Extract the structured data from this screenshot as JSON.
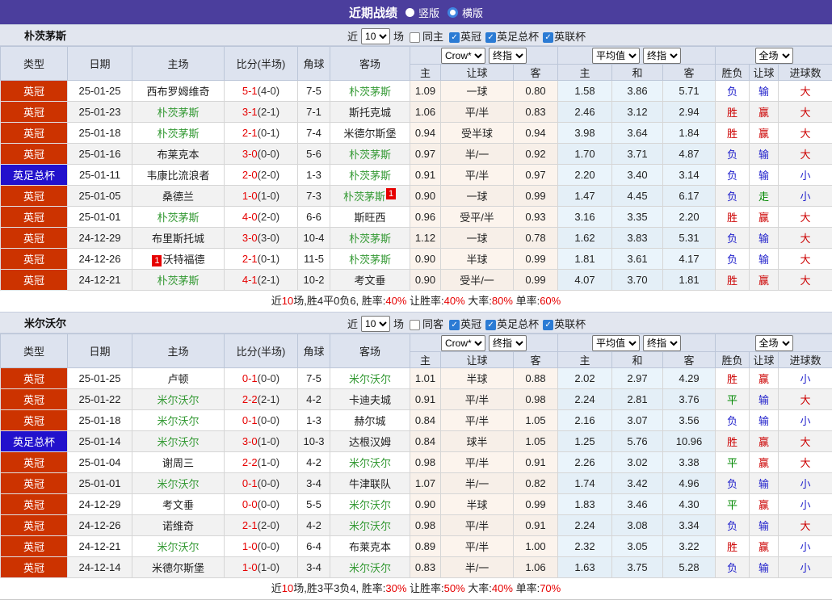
{
  "topbar": {
    "title": "近期战绩",
    "vertical_label": "竖版",
    "horizontal_label": "横版"
  },
  "filter_labels": {
    "near": "近",
    "games_value": "10",
    "games_suffix": "场"
  },
  "table_header": {
    "type": "类型",
    "date": "日期",
    "home": "主场",
    "score": "比分(半场)",
    "corner": "角球",
    "away": "客场",
    "crow_dropdown": "Crow*",
    "crow_final_dropdown": "终指",
    "avg_dropdown": "平均值",
    "avg_final_dropdown": "终指",
    "full_dropdown": "全场",
    "crow_cols": [
      "主",
      "让球",
      "客"
    ],
    "avg_cols": [
      "主",
      "和",
      "客"
    ],
    "result_cols": [
      "胜负",
      "让球",
      "进球数"
    ]
  },
  "colors": {
    "topbar_purple": "#4b3e9d",
    "league_red": "#cc3300",
    "cup_blue": "#2211cc",
    "team_green": "#339933",
    "score_red": "#e60000",
    "win_red": "#cc0000",
    "lose_blue": "#2222cc",
    "draw_green": "#008800"
  },
  "sections": [
    {
      "team": "朴茨茅斯",
      "same_side_label": "同主",
      "same_side_checked": false,
      "league_filters": [
        {
          "label": "英冠",
          "checked": true
        },
        {
          "label": "英足总杯",
          "checked": true
        },
        {
          "label": "英联杯",
          "checked": true
        }
      ],
      "rows": [
        {
          "league": "英冠",
          "league_type": "league",
          "date": "25-01-25",
          "home": "西布罗姆维奇",
          "home_is_team": false,
          "home_card": "",
          "score": "5-1",
          "half": "(4-0)",
          "corners": "7-5",
          "away": "朴茨茅斯",
          "away_is_team": true,
          "away_card": "",
          "crow": [
            "1.09",
            "一球",
            "0.80"
          ],
          "avg": [
            "1.58",
            "3.86",
            "5.71"
          ],
          "results": [
            [
              "负",
              "b"
            ],
            [
              "输",
              "b"
            ],
            [
              "大",
              "r"
            ]
          ]
        },
        {
          "league": "英冠",
          "league_type": "league",
          "date": "25-01-23",
          "home": "朴茨茅斯",
          "home_is_team": true,
          "home_card": "",
          "score": "3-1",
          "half": "(2-1)",
          "corners": "7-1",
          "away": "斯托克城",
          "away_is_team": false,
          "away_card": "",
          "crow": [
            "1.06",
            "平/半",
            "0.83"
          ],
          "avg": [
            "2.46",
            "3.12",
            "2.94"
          ],
          "results": [
            [
              "胜",
              "r"
            ],
            [
              "赢",
              "r"
            ],
            [
              "大",
              "r"
            ]
          ]
        },
        {
          "league": "英冠",
          "league_type": "league",
          "date": "25-01-18",
          "home": "朴茨茅斯",
          "home_is_team": true,
          "home_card": "",
          "score": "2-1",
          "half": "(0-1)",
          "corners": "7-4",
          "away": "米德尔斯堡",
          "away_is_team": false,
          "away_card": "",
          "crow": [
            "0.94",
            "受半球",
            "0.94"
          ],
          "avg": [
            "3.98",
            "3.64",
            "1.84"
          ],
          "results": [
            [
              "胜",
              "r"
            ],
            [
              "赢",
              "r"
            ],
            [
              "大",
              "r"
            ]
          ]
        },
        {
          "league": "英冠",
          "league_type": "league",
          "date": "25-01-16",
          "home": "布莱克本",
          "home_is_team": false,
          "home_card": "",
          "score": "3-0",
          "half": "(0-0)",
          "corners": "5-6",
          "away": "朴茨茅斯",
          "away_is_team": true,
          "away_card": "",
          "crow": [
            "0.97",
            "半/一",
            "0.92"
          ],
          "avg": [
            "1.70",
            "3.71",
            "4.87"
          ],
          "results": [
            [
              "负",
              "b"
            ],
            [
              "输",
              "b"
            ],
            [
              "大",
              "r"
            ]
          ]
        },
        {
          "league": "英足总杯",
          "league_type": "cup",
          "date": "25-01-11",
          "home": "韦康比流浪者",
          "home_is_team": false,
          "home_card": "",
          "score": "2-0",
          "half": "(2-0)",
          "corners": "1-3",
          "away": "朴茨茅斯",
          "away_is_team": true,
          "away_card": "",
          "crow": [
            "0.91",
            "平/半",
            "0.97"
          ],
          "avg": [
            "2.20",
            "3.40",
            "3.14"
          ],
          "results": [
            [
              "负",
              "b"
            ],
            [
              "输",
              "b"
            ],
            [
              "小",
              "b"
            ]
          ]
        },
        {
          "league": "英冠",
          "league_type": "league",
          "date": "25-01-05",
          "home": "桑德兰",
          "home_is_team": false,
          "home_card": "",
          "score": "1-0",
          "half": "(1-0)",
          "corners": "7-3",
          "away": "朴茨茅斯",
          "away_is_team": true,
          "away_card": "1",
          "crow": [
            "0.90",
            "一球",
            "0.99"
          ],
          "avg": [
            "1.47",
            "4.45",
            "6.17"
          ],
          "results": [
            [
              "负",
              "b"
            ],
            [
              "走",
              "g"
            ],
            [
              "小",
              "b"
            ]
          ]
        },
        {
          "league": "英冠",
          "league_type": "league",
          "date": "25-01-01",
          "home": "朴茨茅斯",
          "home_is_team": true,
          "home_card": "",
          "score": "4-0",
          "half": "(2-0)",
          "corners": "6-6",
          "away": "斯旺西",
          "away_is_team": false,
          "away_card": "",
          "crow": [
            "0.96",
            "受平/半",
            "0.93"
          ],
          "avg": [
            "3.16",
            "3.35",
            "2.20"
          ],
          "results": [
            [
              "胜",
              "r"
            ],
            [
              "赢",
              "r"
            ],
            [
              "大",
              "r"
            ]
          ]
        },
        {
          "league": "英冠",
          "league_type": "league",
          "date": "24-12-29",
          "home": "布里斯托城",
          "home_is_team": false,
          "home_card": "",
          "score": "3-0",
          "half": "(3-0)",
          "corners": "10-4",
          "away": "朴茨茅斯",
          "away_is_team": true,
          "away_card": "",
          "crow": [
            "1.12",
            "一球",
            "0.78"
          ],
          "avg": [
            "1.62",
            "3.83",
            "5.31"
          ],
          "results": [
            [
              "负",
              "b"
            ],
            [
              "输",
              "b"
            ],
            [
              "大",
              "r"
            ]
          ]
        },
        {
          "league": "英冠",
          "league_type": "league",
          "date": "24-12-26",
          "home": "沃特福德",
          "home_is_team": false,
          "home_card": "1",
          "score": "2-1",
          "half": "(0-1)",
          "corners": "11-5",
          "away": "朴茨茅斯",
          "away_is_team": true,
          "away_card": "",
          "crow": [
            "0.90",
            "半球",
            "0.99"
          ],
          "avg": [
            "1.81",
            "3.61",
            "4.17"
          ],
          "results": [
            [
              "负",
              "b"
            ],
            [
              "输",
              "b"
            ],
            [
              "大",
              "r"
            ]
          ]
        },
        {
          "league": "英冠",
          "league_type": "league",
          "date": "24-12-21",
          "home": "朴茨茅斯",
          "home_is_team": true,
          "home_card": "",
          "score": "4-1",
          "half": "(2-1)",
          "corners": "10-2",
          "away": "考文垂",
          "away_is_team": false,
          "away_card": "",
          "crow": [
            "0.90",
            "受半/一",
            "0.99"
          ],
          "avg": [
            "4.07",
            "3.70",
            "1.81"
          ],
          "results": [
            [
              "胜",
              "r"
            ],
            [
              "赢",
              "r"
            ],
            [
              "大",
              "r"
            ]
          ]
        }
      ],
      "summary": [
        {
          "t": "近",
          "red": false
        },
        {
          "t": "10",
          "red": true
        },
        {
          "t": "场,胜4平0负6, 胜率:",
          "red": false
        },
        {
          "t": "40%",
          "red": true
        },
        {
          "t": " 让胜率:",
          "red": false
        },
        {
          "t": "40%",
          "red": true
        },
        {
          "t": " 大率:",
          "red": false
        },
        {
          "t": "80%",
          "red": true
        },
        {
          "t": " 单率:",
          "red": false
        },
        {
          "t": "60%",
          "red": true
        }
      ]
    },
    {
      "team": "米尔沃尔",
      "same_side_label": "同客",
      "same_side_checked": false,
      "league_filters": [
        {
          "label": "英冠",
          "checked": true
        },
        {
          "label": "英足总杯",
          "checked": true
        },
        {
          "label": "英联杯",
          "checked": true
        }
      ],
      "rows": [
        {
          "league": "英冠",
          "league_type": "league",
          "date": "25-01-25",
          "home": "卢顿",
          "home_is_team": false,
          "home_card": "",
          "score": "0-1",
          "half": "(0-0)",
          "corners": "7-5",
          "away": "米尔沃尔",
          "away_is_team": true,
          "away_card": "",
          "crow": [
            "1.01",
            "半球",
            "0.88"
          ],
          "avg": [
            "2.02",
            "2.97",
            "4.29"
          ],
          "results": [
            [
              "胜",
              "r"
            ],
            [
              "赢",
              "r"
            ],
            [
              "小",
              "b"
            ]
          ]
        },
        {
          "league": "英冠",
          "league_type": "league",
          "date": "25-01-22",
          "home": "米尔沃尔",
          "home_is_team": true,
          "home_card": "",
          "score": "2-2",
          "half": "(2-1)",
          "corners": "4-2",
          "away": "卡迪夫城",
          "away_is_team": false,
          "away_card": "",
          "crow": [
            "0.91",
            "平/半",
            "0.98"
          ],
          "avg": [
            "2.24",
            "2.81",
            "3.76"
          ],
          "results": [
            [
              "平",
              "g"
            ],
            [
              "输",
              "b"
            ],
            [
              "大",
              "r"
            ]
          ]
        },
        {
          "league": "英冠",
          "league_type": "league",
          "date": "25-01-18",
          "home": "米尔沃尔",
          "home_is_team": true,
          "home_card": "",
          "score": "0-1",
          "half": "(0-0)",
          "corners": "1-3",
          "away": "赫尔城",
          "away_is_team": false,
          "away_card": "",
          "crow": [
            "0.84",
            "平/半",
            "1.05"
          ],
          "avg": [
            "2.16",
            "3.07",
            "3.56"
          ],
          "results": [
            [
              "负",
              "b"
            ],
            [
              "输",
              "b"
            ],
            [
              "小",
              "b"
            ]
          ]
        },
        {
          "league": "英足总杯",
          "league_type": "cup",
          "date": "25-01-14",
          "home": "米尔沃尔",
          "home_is_team": true,
          "home_card": "",
          "score": "3-0",
          "half": "(1-0)",
          "corners": "10-3",
          "away": "达根汉姆",
          "away_is_team": false,
          "away_card": "",
          "crow": [
            "0.84",
            "球半",
            "1.05"
          ],
          "avg": [
            "1.25",
            "5.76",
            "10.96"
          ],
          "results": [
            [
              "胜",
              "r"
            ],
            [
              "赢",
              "r"
            ],
            [
              "大",
              "r"
            ]
          ]
        },
        {
          "league": "英冠",
          "league_type": "league",
          "date": "25-01-04",
          "home": "谢周三",
          "home_is_team": false,
          "home_card": "",
          "score": "2-2",
          "half": "(1-0)",
          "corners": "4-2",
          "away": "米尔沃尔",
          "away_is_team": true,
          "away_card": "",
          "crow": [
            "0.98",
            "平/半",
            "0.91"
          ],
          "avg": [
            "2.26",
            "3.02",
            "3.38"
          ],
          "results": [
            [
              "平",
              "g"
            ],
            [
              "赢",
              "r"
            ],
            [
              "大",
              "r"
            ]
          ]
        },
        {
          "league": "英冠",
          "league_type": "league",
          "date": "25-01-01",
          "home": "米尔沃尔",
          "home_is_team": true,
          "home_card": "",
          "score": "0-1",
          "half": "(0-0)",
          "corners": "3-4",
          "away": "牛津联队",
          "away_is_team": false,
          "away_card": "",
          "crow": [
            "1.07",
            "半/一",
            "0.82"
          ],
          "avg": [
            "1.74",
            "3.42",
            "4.96"
          ],
          "results": [
            [
              "负",
              "b"
            ],
            [
              "输",
              "b"
            ],
            [
              "小",
              "b"
            ]
          ]
        },
        {
          "league": "英冠",
          "league_type": "league",
          "date": "24-12-29",
          "home": "考文垂",
          "home_is_team": false,
          "home_card": "",
          "score": "0-0",
          "half": "(0-0)",
          "corners": "5-5",
          "away": "米尔沃尔",
          "away_is_team": true,
          "away_card": "",
          "crow": [
            "0.90",
            "半球",
            "0.99"
          ],
          "avg": [
            "1.83",
            "3.46",
            "4.30"
          ],
          "results": [
            [
              "平",
              "g"
            ],
            [
              "赢",
              "r"
            ],
            [
              "小",
              "b"
            ]
          ]
        },
        {
          "league": "英冠",
          "league_type": "league",
          "date": "24-12-26",
          "home": "诺维奇",
          "home_is_team": false,
          "home_card": "",
          "score": "2-1",
          "half": "(2-0)",
          "corners": "4-2",
          "away": "米尔沃尔",
          "away_is_team": true,
          "away_card": "",
          "crow": [
            "0.98",
            "平/半",
            "0.91"
          ],
          "avg": [
            "2.24",
            "3.08",
            "3.34"
          ],
          "results": [
            [
              "负",
              "b"
            ],
            [
              "输",
              "b"
            ],
            [
              "大",
              "r"
            ]
          ]
        },
        {
          "league": "英冠",
          "league_type": "league",
          "date": "24-12-21",
          "home": "米尔沃尔",
          "home_is_team": true,
          "home_card": "",
          "score": "1-0",
          "half": "(0-0)",
          "corners": "6-4",
          "away": "布莱克本",
          "away_is_team": false,
          "away_card": "",
          "crow": [
            "0.89",
            "平/半",
            "1.00"
          ],
          "avg": [
            "2.32",
            "3.05",
            "3.22"
          ],
          "results": [
            [
              "胜",
              "r"
            ],
            [
              "赢",
              "r"
            ],
            [
              "小",
              "b"
            ]
          ]
        },
        {
          "league": "英冠",
          "league_type": "league",
          "date": "24-12-14",
          "home": "米德尔斯堡",
          "home_is_team": false,
          "home_card": "",
          "score": "1-0",
          "half": "(1-0)",
          "corners": "3-4",
          "away": "米尔沃尔",
          "away_is_team": true,
          "away_card": "",
          "crow": [
            "0.83",
            "半/一",
            "1.06"
          ],
          "avg": [
            "1.63",
            "3.75",
            "5.28"
          ],
          "results": [
            [
              "负",
              "b"
            ],
            [
              "输",
              "b"
            ],
            [
              "小",
              "b"
            ]
          ]
        }
      ],
      "summary": [
        {
          "t": "近",
          "red": false
        },
        {
          "t": "10",
          "red": true
        },
        {
          "t": "场,胜3平3负4, 胜率:",
          "red": false
        },
        {
          "t": "30%",
          "red": true
        },
        {
          "t": " 让胜率:",
          "red": false
        },
        {
          "t": "50%",
          "red": true
        },
        {
          "t": " 大率:",
          "red": false
        },
        {
          "t": "40%",
          "red": true
        },
        {
          "t": " 单率:",
          "red": false
        },
        {
          "t": "70%",
          "red": true
        }
      ]
    }
  ]
}
